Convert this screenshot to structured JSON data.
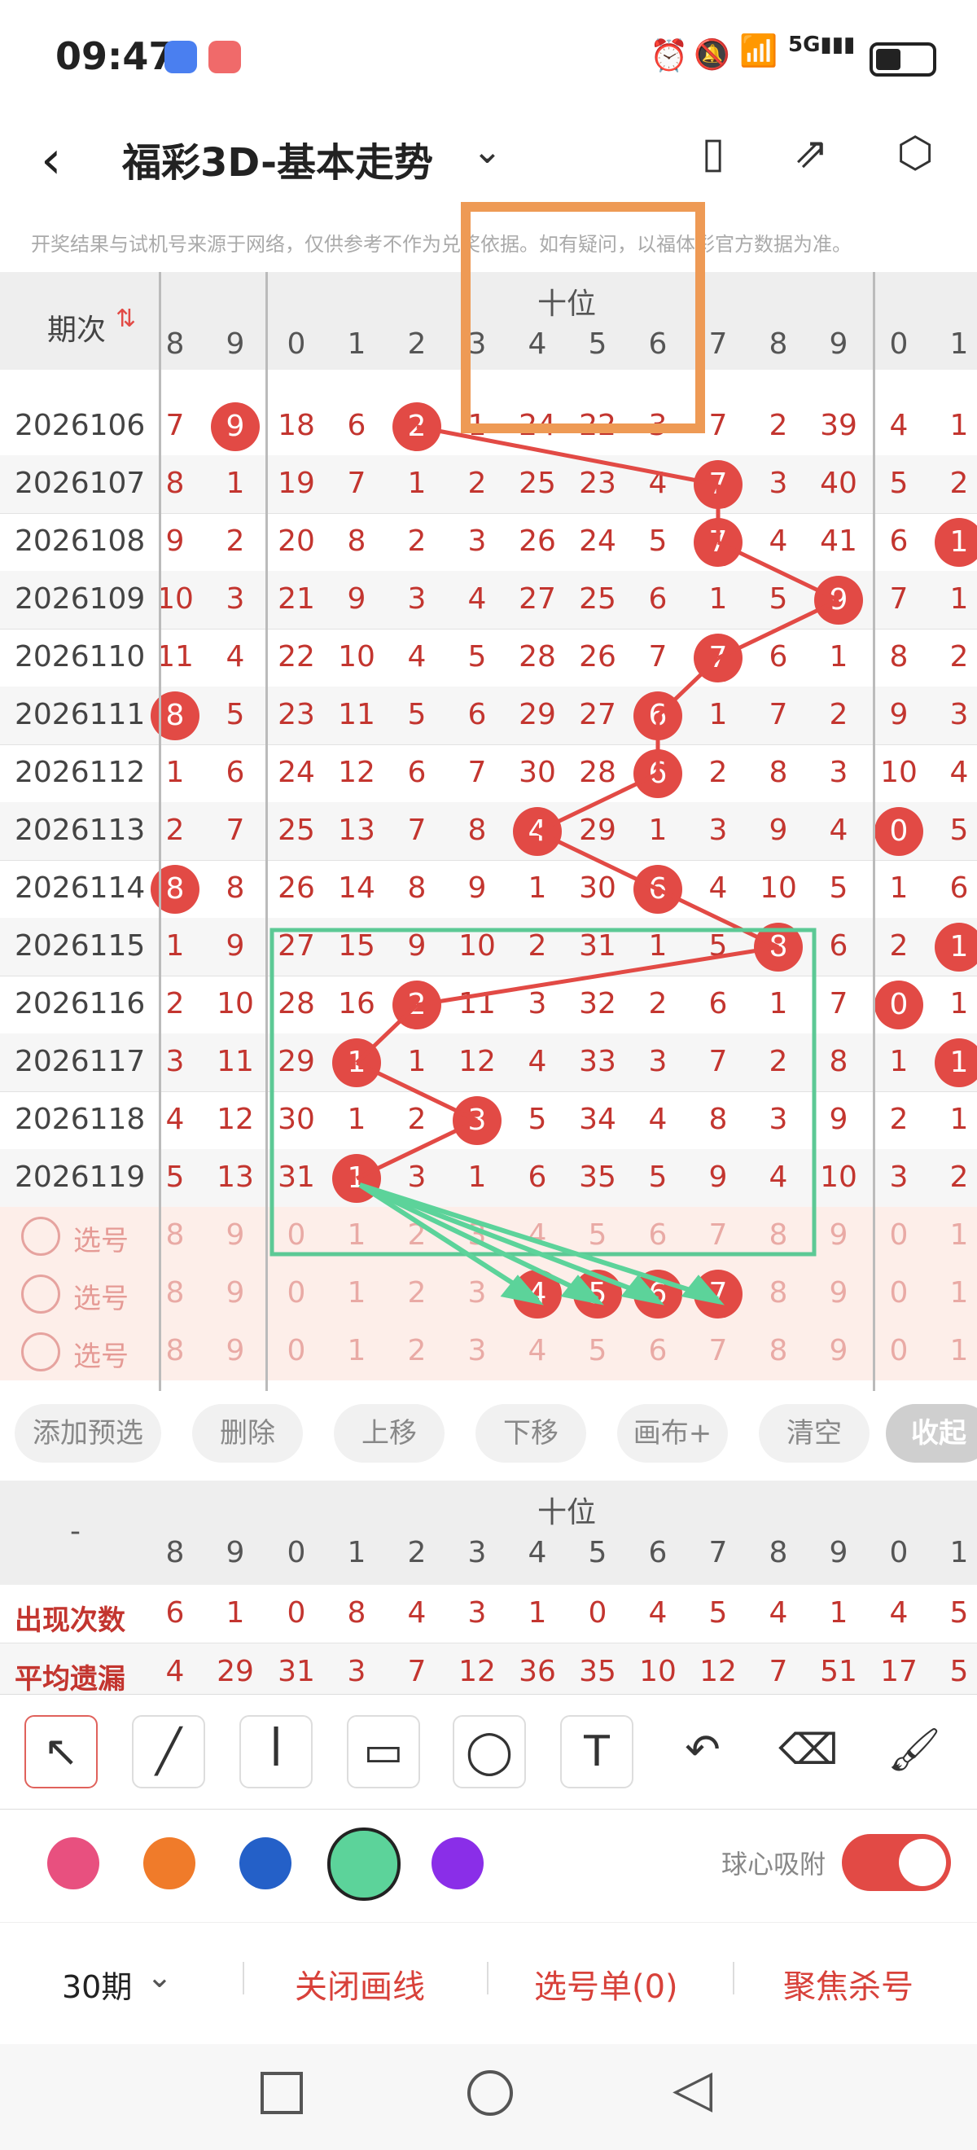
{
  "status_bar": {
    "time": "09:47",
    "icons": [
      "alarm-icon",
      "mute-icon",
      "wifi-icon",
      "signal-5g-icon",
      "battery-icon"
    ]
  },
  "header": {
    "title": "福彩3D-基本走势",
    "notice": "开奖结果与试机号来源于网络，仅供参考不作为兑奖依据。如有疑问，以福体彩官方数据为准。"
  },
  "table": {
    "period_header": "期次",
    "group_label": "十位",
    "column_digits": [
      "8",
      "9",
      "0",
      "1",
      "2",
      "3",
      "4",
      "5",
      "6",
      "7",
      "8",
      "9",
      "0",
      "1"
    ],
    "rows": [
      {
        "period": "2026106",
        "cells": [
          "7",
          "9",
          "18",
          "6",
          "2",
          "1",
          "24",
          "22",
          "3",
          "7",
          "2",
          "39",
          "4",
          "1"
        ],
        "balls": [
          1,
          4
        ]
      },
      {
        "period": "2026107",
        "cells": [
          "8",
          "1",
          "19",
          "7",
          "1",
          "2",
          "25",
          "23",
          "4",
          "7",
          "3",
          "40",
          "5",
          "2"
        ],
        "balls": [
          9
        ]
      },
      {
        "period": "2026108",
        "cells": [
          "9",
          "2",
          "20",
          "8",
          "2",
          "3",
          "26",
          "24",
          "5",
          "7",
          "4",
          "41",
          "6",
          "1"
        ],
        "balls": [
          9,
          13
        ]
      },
      {
        "period": "2026109",
        "cells": [
          "10",
          "3",
          "21",
          "9",
          "3",
          "4",
          "27",
          "25",
          "6",
          "1",
          "5",
          "9",
          "7",
          "1"
        ],
        "balls": [
          11
        ]
      },
      {
        "period": "2026110",
        "cells": [
          "11",
          "4",
          "22",
          "10",
          "4",
          "5",
          "28",
          "26",
          "7",
          "7",
          "6",
          "1",
          "8",
          "2"
        ],
        "balls": [
          9
        ]
      },
      {
        "period": "2026111",
        "cells": [
          "8",
          "5",
          "23",
          "11",
          "5",
          "6",
          "29",
          "27",
          "6",
          "1",
          "7",
          "2",
          "9",
          "3"
        ],
        "balls": [
          0,
          8
        ]
      },
      {
        "period": "2026112",
        "cells": [
          "1",
          "6",
          "24",
          "12",
          "6",
          "7",
          "30",
          "28",
          "6",
          "2",
          "8",
          "3",
          "10",
          "4"
        ],
        "balls": [
          8
        ]
      },
      {
        "period": "2026113",
        "cells": [
          "2",
          "7",
          "25",
          "13",
          "7",
          "8",
          "4",
          "29",
          "1",
          "3",
          "9",
          "4",
          "0",
          "5"
        ],
        "balls": [
          6,
          12
        ]
      },
      {
        "period": "2026114",
        "cells": [
          "8",
          "8",
          "26",
          "14",
          "8",
          "9",
          "1",
          "30",
          "6",
          "4",
          "10",
          "5",
          "1",
          "6"
        ],
        "balls": [
          0,
          8
        ]
      },
      {
        "period": "2026115",
        "cells": [
          "1",
          "9",
          "27",
          "15",
          "9",
          "10",
          "2",
          "31",
          "1",
          "5",
          "8",
          "6",
          "2",
          "1"
        ],
        "balls": [
          10,
          13
        ]
      },
      {
        "period": "2026116",
        "cells": [
          "2",
          "10",
          "28",
          "16",
          "2",
          "11",
          "3",
          "32",
          "2",
          "6",
          "1",
          "7",
          "0",
          "1"
        ],
        "balls": [
          4,
          12
        ]
      },
      {
        "period": "2026117",
        "cells": [
          "3",
          "11",
          "29",
          "1",
          "1",
          "12",
          "4",
          "33",
          "3",
          "7",
          "2",
          "8",
          "1",
          "1"
        ],
        "balls": [
          3,
          13
        ]
      },
      {
        "period": "2026118",
        "cells": [
          "4",
          "12",
          "30",
          "1",
          "2",
          "3",
          "5",
          "34",
          "4",
          "8",
          "3",
          "9",
          "2",
          "1"
        ],
        "balls": [
          5
        ]
      },
      {
        "period": "2026119",
        "cells": [
          "5",
          "13",
          "31",
          "1",
          "3",
          "1",
          "6",
          "35",
          "5",
          "9",
          "4",
          "10",
          "3",
          "2"
        ],
        "balls": [
          3
        ]
      }
    ],
    "select_rows": [
      {
        "label": "选号",
        "cells": [
          "8",
          "9",
          "0",
          "1",
          "2",
          "3",
          "4",
          "5",
          "6",
          "7",
          "8",
          "9",
          "0",
          "1"
        ],
        "balls": []
      },
      {
        "label": "选号",
        "cells": [
          "8",
          "9",
          "0",
          "1",
          "2",
          "3",
          "4",
          "5",
          "6",
          "7",
          "8",
          "9",
          "0",
          "1"
        ],
        "balls": [
          6,
          7,
          8,
          9
        ]
      },
      {
        "label": "选号",
        "cells": [
          "8",
          "9",
          "0",
          "1",
          "2",
          "3",
          "4",
          "5",
          "6",
          "7",
          "8",
          "9",
          "0",
          "1"
        ],
        "balls": []
      }
    ]
  },
  "actions": [
    "添加预选",
    "删除",
    "上移",
    "下移",
    "画布+",
    "清空",
    "收起"
  ],
  "stats": {
    "group_label": "十位",
    "dash": "-",
    "column_digits": [
      "8",
      "9",
      "0",
      "1",
      "2",
      "3",
      "4",
      "5",
      "6",
      "7",
      "8",
      "9",
      "0",
      "1"
    ],
    "rows": [
      {
        "label": "出现次数",
        "cells": [
          "6",
          "1",
          "0",
          "8",
          "4",
          "3",
          "1",
          "0",
          "4",
          "5",
          "4",
          "1",
          "4",
          "5"
        ]
      },
      {
        "label": "平均遗漏",
        "cells": [
          "4",
          "29",
          "31",
          "3",
          "7",
          "12",
          "36",
          "35",
          "10",
          "12",
          "7",
          "51",
          "17",
          "5"
        ]
      }
    ]
  },
  "drawing_tools": [
    "arrow-tool-icon",
    "line-tool-icon",
    "curve-tool-icon",
    "rectangle-tool-icon",
    "circle-tool-icon",
    "text-tool-icon",
    "undo-icon",
    "eraser-icon",
    "brush-icon"
  ],
  "colors": [
    "#e8507f",
    "#f07b2a",
    "#2460c8",
    "#5cd39a",
    "#8a2ee8"
  ],
  "snap_label": "球心吸附",
  "footer": {
    "periods": "30期",
    "close_draw": "关闭画线",
    "selection": "选号单(0)",
    "focus_kill": "聚焦杀号"
  }
}
